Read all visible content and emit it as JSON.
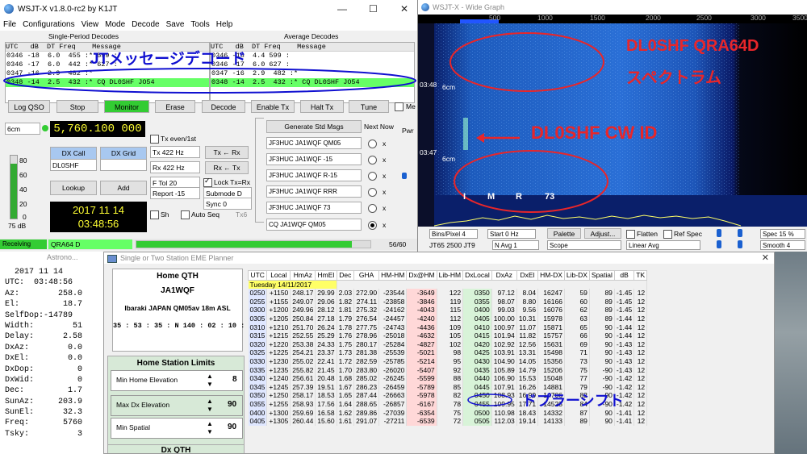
{
  "wsjtx": {
    "title": "WSJT-X   v1.8.0-rc2   by K1JT",
    "menu": [
      "File",
      "Configurations",
      "View",
      "Mode",
      "Decode",
      "Save",
      "Tools",
      "Help"
    ],
    "single_period_label": "Single-Period Decodes",
    "average_label": "Average Decodes",
    "left_header": "UTC   dB  DT Freq    Message",
    "right_header": "UTC   dB  DT Freq    Message",
    "left_rows": [
      "0346 -18  6.0  455 :* 599 :",
      "0346 -17  6.0  442 :* 627 :",
      "0347 -16  2.9  482 :*",
      "0348 -14  2.5  432 :* CQ DL0SHF JO54"
    ],
    "right_rows": [
      "0346 -18  4.4 599 :",
      "0346 -17  6.0 627 :",
      "0347 -16  2.9  482 :*",
      "0348 -14  2.5  432 :* CQ DL0SHF JO54"
    ],
    "buttons": {
      "log_qso": "Log QSO",
      "stop": "Stop",
      "monitor": "Monitor",
      "erase": "Erase",
      "decode": "Decode",
      "enable_tx": "Enable Tx",
      "halt_tx": "Halt Tx",
      "tune": "Tune",
      "menus": "Me"
    },
    "band": "6cm",
    "frequency": "5,760.100 000",
    "tx_even": "Tx even/1st",
    "tx_hz": "Tx  422  Hz",
    "rx_hz": "Rx  422  Hz",
    "tx_to_rx": "Tx ← Rx",
    "rx_to_tx": "Rx ← Tx",
    "ftol": "F Tol  20",
    "lock": "Lock Tx=Rx",
    "report": "Report  -15",
    "submode": "Submode  D",
    "sync": "Sync    0",
    "sh": "Sh",
    "auto_seq": "Auto Seq",
    "tx6": "Tx6",
    "dx_call_btn": "DX Call",
    "dx_grid_btn": "DX Grid",
    "dx_call": "DL0SHF",
    "dx_grid": "",
    "lookup": "Lookup",
    "add": "Add",
    "date": "2017 11 14",
    "time": "03:48:56",
    "meter_ticks": [
      "80",
      "60",
      "40",
      "20",
      "0"
    ],
    "meter_db": "75 dB",
    "gen_std": "Generate Std Msgs",
    "next_now": "Next  Now",
    "pwr": "Pwr",
    "messages": [
      "JF3HUC JA1WQF QM05",
      "JF3HUC JA1WQF -15",
      "JF3HUC JA1WQF R-15",
      "JF3HUC JA1WQF RRR",
      "JF3HUC JA1WQF 73",
      "CQ JA1WQF QM05"
    ],
    "receiving": "Receiving",
    "mode": "QRA64 D",
    "counter": "56/60",
    "progress": 0.92,
    "ann_jt": "JTメッセージデコード"
  },
  "wide": {
    "title": "WSJT-X - Wide Graph",
    "freq_ticks": [
      "500",
      "1000",
      "1500",
      "2000",
      "2500",
      "3000",
      "3500"
    ],
    "time_labels": [
      "03:48",
      "6cm",
      "03:47",
      "6cm"
    ],
    "ann_qra": "DL0SHF QRA64D",
    "ann_spec": "スペクトラム",
    "ann_cw": "DL0SHF CW ID",
    "cw_letters": [
      "I",
      "M",
      "R",
      "73"
    ],
    "controls": {
      "bins": "Bins/Pixel  4",
      "start": "Start  0 Hz",
      "palette": "Palette",
      "adjust": "Adjust...",
      "flatten": "Flatten",
      "ref_spec": "Ref Spec",
      "spec": "Spec 15 %",
      "jt65": "JT65  2500  JT9",
      "navg": "N Avg  1",
      "scope": "Scope",
      "linear": "Linear Avg",
      "smooth": "Smooth  4"
    }
  },
  "astro": {
    "title": "Astrono...",
    "rows": [
      "  2017 11 14",
      "UTC:  03:48:56",
      "Az:        258.0",
      "El:         18.7",
      "SelfDop:-14789",
      "Width:        51",
      "Delay:      2.58",
      "DxAz:        0.0",
      "DxEl:        0.0",
      "DxDop:         0",
      "DxWid:         0",
      "Dec:         1.7",
      "SunAz:     203.9",
      "SunEl:      32.3",
      "Freq:       5760",
      "Tsky:          3"
    ]
  },
  "eme": {
    "title": "Single or Two Station EME Planner",
    "home_qth_label": "Home  QTH",
    "home_call": "JA1WQF",
    "home_loc": "Ibaraki JAPAN  QM05av  18m ASL",
    "home_coords": "35 : 53 : 35 : N   140 : 02 : 10 : E",
    "limits_label": "Home Station Limits",
    "min_elev_label": "Min  Home Elevation",
    "min_elev": "8",
    "max_dx_label": "Max  Dx  Elevation",
    "max_dx": "90",
    "min_spatial_label": "Min  Spatial",
    "min_spatial": "90",
    "dx_qth_label": "Dx  QTH",
    "columns": [
      "UTC",
      "Local",
      "HmAz",
      "HmEl",
      "Dec",
      "GHA",
      "HM-HM",
      "Dx@HM",
      "Lib-HM",
      "DxLocal",
      "DxAz",
      "DxEl",
      "HM-DX",
      "Lib-DX",
      "Spatial",
      "dB",
      "TK"
    ],
    "date_row": "Tuesday 14/11/2017",
    "rows": [
      [
        "0250",
        "+1150",
        "248.17",
        "29.99",
        "2.03",
        "272.90",
        "-23544",
        "-3649",
        "122",
        "0350",
        "97.12",
        "8.04",
        "16247",
        "59",
        "89",
        "-1.45",
        "12"
      ],
      [
        "0255",
        "+1155",
        "249.07",
        "29.06",
        "1.82",
        "274.11",
        "-23858",
        "-3846",
        "119",
        "0355",
        "98.07",
        "8.80",
        "16166",
        "60",
        "89",
        "-1.45",
        "12"
      ],
      [
        "0300",
        "+1200",
        "249.96",
        "28.12",
        "1.81",
        "275.32",
        "-24162",
        "-4043",
        "115",
        "0400",
        "99.03",
        "9.56",
        "16076",
        "62",
        "89",
        "-1.45",
        "12"
      ],
      [
        "0305",
        "+1205",
        "250.84",
        "27.18",
        "1.79",
        "276.54",
        "-24457",
        "-4240",
        "112",
        "0405",
        "100.00",
        "10.31",
        "15978",
        "63",
        "89",
        "-1.44",
        "12"
      ],
      [
        "0310",
        "+1210",
        "251.70",
        "26.24",
        "1.78",
        "277.75",
        "-24743",
        "-4436",
        "109",
        "0410",
        "100.97",
        "11.07",
        "15871",
        "65",
        "90",
        "-1.44",
        "12"
      ],
      [
        "0315",
        "+1215",
        "252.55",
        "25.29",
        "1.76",
        "278.96",
        "-25018",
        "-4632",
        "105",
        "0415",
        "101.94",
        "11.82",
        "15757",
        "66",
        "90",
        "-1.44",
        "12"
      ],
      [
        "0320",
        "+1220",
        "253.38",
        "24.33",
        "1.75",
        "280.17",
        "-25284",
        "-4827",
        "102",
        "0420",
        "102.92",
        "12.56",
        "15631",
        "69",
        "90",
        "-1.43",
        "12"
      ],
      [
        "0325",
        "+1225",
        "254.21",
        "23.37",
        "1.73",
        "281.38",
        "-25539",
        "-5021",
        "98",
        "0425",
        "103.91",
        "13.31",
        "15498",
        "71",
        "90",
        "-1.43",
        "12"
      ],
      [
        "0330",
        "+1230",
        "255.02",
        "22.41",
        "1.72",
        "282.59",
        "-25785",
        "-5214",
        "95",
        "0430",
        "104.90",
        "14.05",
        "15356",
        "73",
        "90",
        "-1.43",
        "12"
      ],
      [
        "0335",
        "+1235",
        "255.82",
        "21.45",
        "1.70",
        "283.80",
        "-26020",
        "-5407",
        "92",
        "0435",
        "105.89",
        "14.79",
        "15206",
        "75",
        "-90",
        "-1.43",
        "12"
      ],
      [
        "0340",
        "+1240",
        "256.61",
        "20.48",
        "1.68",
        "285.02",
        "-26245",
        "-5599",
        "88",
        "0440",
        "106.90",
        "15.53",
        "15048",
        "77",
        "-90",
        "-1.42",
        "12"
      ],
      [
        "0345",
        "+1245",
        "257.39",
        "19.51",
        "1.67",
        "286.23",
        "-26459",
        "-5789",
        "85",
        "0445",
        "107.91",
        "16.26",
        "14881",
        "79",
        "-90",
        "-1.42",
        "12"
      ],
      [
        "0350",
        "+1250",
        "258.17",
        "18.53",
        "1.65",
        "287.44",
        "-26663",
        "-5978",
        "82",
        "0450",
        "108.93",
        "16.99",
        "14706",
        "82",
        "-90",
        "-1.42",
        "12"
      ],
      [
        "0355",
        "+1255",
        "258.93",
        "17.56",
        "1.64",
        "288.65",
        "-26857",
        "-6167",
        "78",
        "0455",
        "109.95",
        "17.71",
        "14523",
        "84",
        "-90",
        "-1.42",
        "12"
      ],
      [
        "0400",
        "+1300",
        "259.69",
        "16.58",
        "1.62",
        "289.86",
        "-27039",
        "-6354",
        "75",
        "0500",
        "110.98",
        "18.43",
        "14332",
        "87",
        "90",
        "-1.41",
        "12"
      ],
      [
        "0405",
        "+1305",
        "260.44",
        "15.60",
        "1.61",
        "291.07",
        "-27211",
        "-6539",
        "72",
        "0505",
        "112.03",
        "19.14",
        "14133",
        "89",
        "90",
        "-1.41",
        "12"
      ]
    ],
    "ann_doppler": "ドプラーシフト"
  },
  "colors": {
    "annotation_red": "#e8262a",
    "annotation_blue": "#1010d0",
    "decode_green": "#66ff66",
    "monitor_green": "#33cc33",
    "freq_bg": "#000000",
    "freq_fg": "#ffff33"
  }
}
